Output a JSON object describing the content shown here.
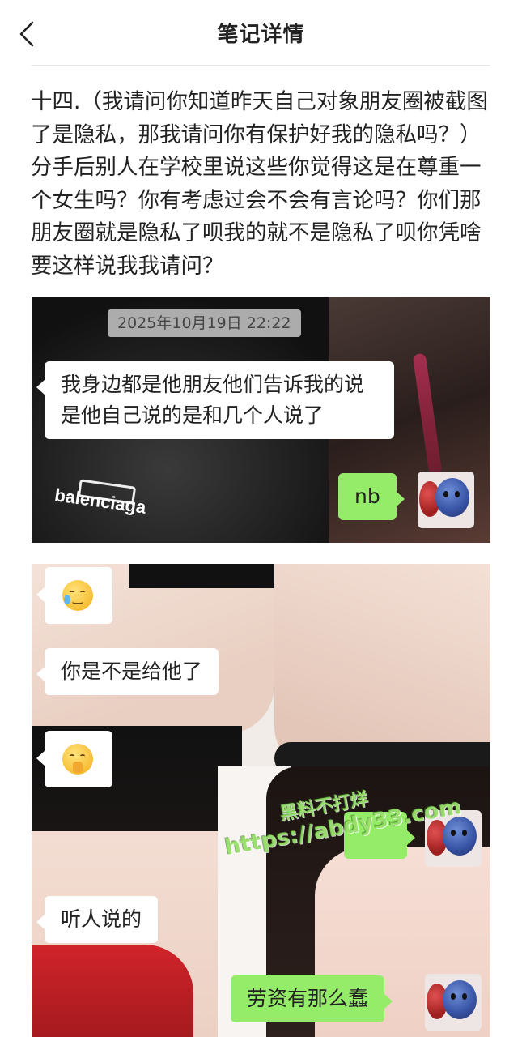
{
  "nav": {
    "title": "笔记详情",
    "back_icon": "chevron-left-icon"
  },
  "note": {
    "body": "十四.（我请问你知道昨天自己对象朋友圈被截图了是隐私，那我请问你有保护好我的隐私吗？）分手后别人在学校里说这些你觉得这是在尊重一个女生吗？你有考虑过会不会有言论吗？你们那朋友圈就是隐私了呗我的就不是隐私了呗你凭啥要这样说我我请问？"
  },
  "screenshot1": {
    "timestamp": "2025年10月19日 22:22",
    "brand_text": "balenciaga",
    "messages": [
      {
        "side": "left",
        "text": "我身边都是他朋友他们告诉我的说是他自己说的是和几个人说了"
      },
      {
        "side": "right",
        "text": "nb"
      }
    ]
  },
  "screenshot2": {
    "messages": [
      {
        "side": "left",
        "type": "emoji",
        "emoji": "crying-laughing-emoji"
      },
      {
        "side": "left",
        "text": "你是不是给他了"
      },
      {
        "side": "left",
        "type": "emoji",
        "emoji": "shushing-face-emoji"
      },
      {
        "side": "right",
        "text": ""
      },
      {
        "side": "left",
        "text": "听人说的"
      },
      {
        "side": "right",
        "text": "劳资有那么蠢"
      }
    ]
  },
  "watermark": {
    "line1": "黑料不打烊",
    "line2": "https://abdy33.com"
  },
  "colors": {
    "bubble_right": "#95ec69",
    "bubble_left": "#ffffff",
    "watermark": "#8cdc5a"
  }
}
